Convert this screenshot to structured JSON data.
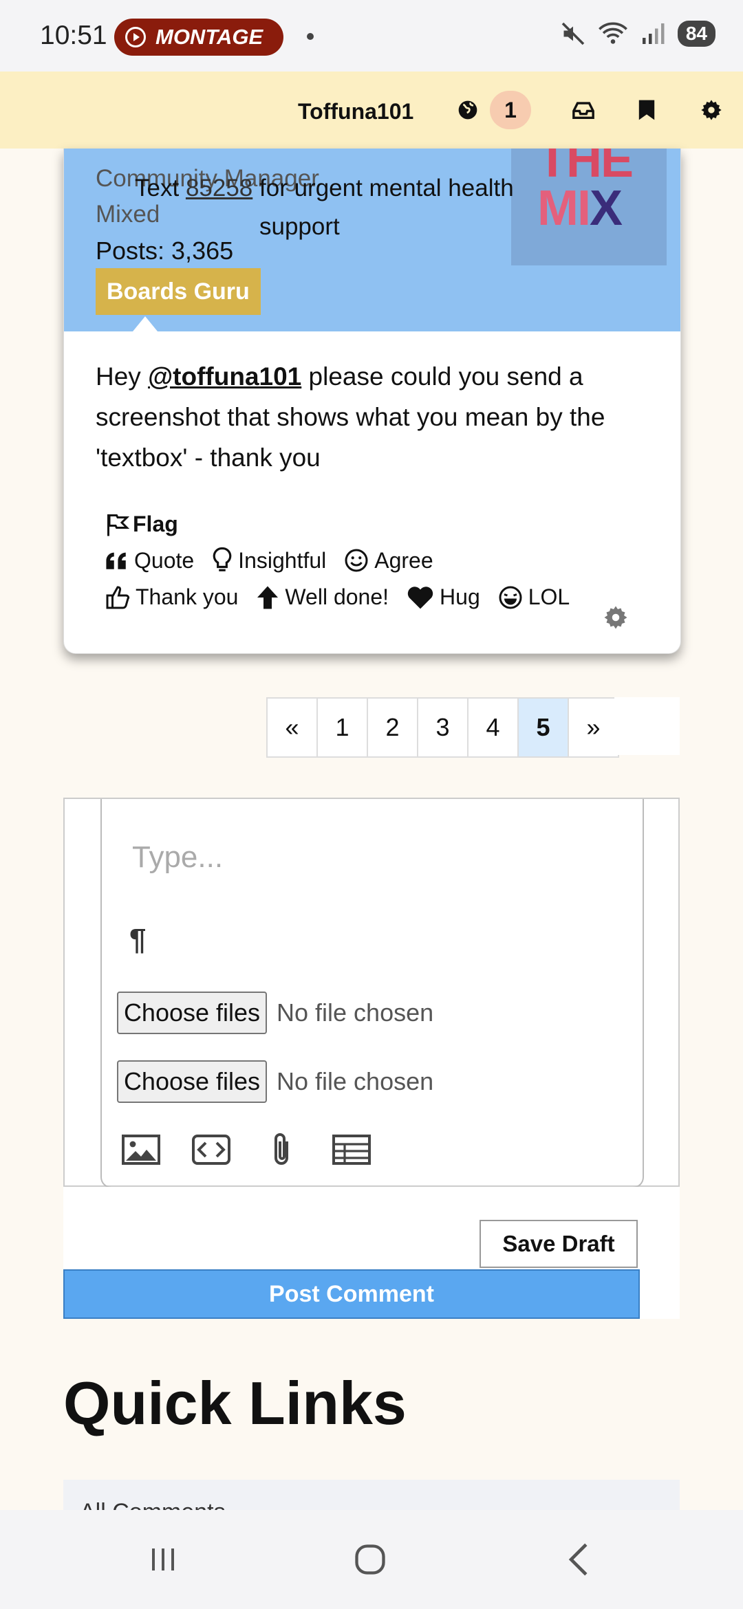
{
  "status_bar": {
    "time": "10:51",
    "recording_label": "MONTAGE",
    "battery": "84"
  },
  "topnav": {
    "username": "Toffuna101",
    "notification_count": "1"
  },
  "comment": {
    "author_role": "Community Manager",
    "author_team": "Mixed",
    "helpline_prefix": "Text",
    "helpline_number": "85258",
    "helpline_suffix": "for urgent mental health support",
    "posts": "Posts: 3,365",
    "rank": "Boards Guru",
    "avatar_text": "THE MIX",
    "body_prefix": "Hey",
    "mention": "@toffuna101",
    "body_suffix": "please could you send a screenshot that shows what you mean by the 'textbox' - thank you",
    "flag_label": "Flag",
    "reactions_row1": [
      "Quote",
      "Insightful",
      "Agree"
    ],
    "reactions_row2": [
      "Thank you",
      "Well done!",
      "Hug",
      "LOL"
    ]
  },
  "pagination": {
    "prev": "«",
    "pages": [
      "1",
      "2",
      "3",
      "4",
      "5"
    ],
    "current": "5",
    "next": "»"
  },
  "editor": {
    "placeholder": "Type...",
    "pilcrow": "¶",
    "file_button": "Choose files",
    "file_status": "No file chosen"
  },
  "actions": {
    "save_draft": "Save Draft",
    "post_comment": "Post Comment"
  },
  "quick_links": {
    "title": "Quick Links",
    "first_item": "All Comments"
  },
  "colors": {
    "nav_bg": "#fcefc3",
    "card_head": "#8fc1f2",
    "rank_bg": "#d6b34b",
    "post_button": "#5aa7f0",
    "active_page": "#d9ebfc"
  }
}
